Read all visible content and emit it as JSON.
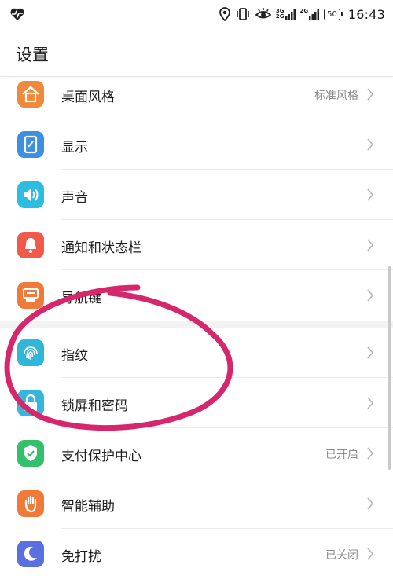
{
  "status_bar": {
    "signal_a": "3G",
    "signal_b": "2G",
    "network_type": "2G",
    "battery": "50",
    "time": "16:43"
  },
  "header": {
    "title": "设置"
  },
  "settings": {
    "items": [
      {
        "label": "桌面风格",
        "value": "标准风格",
        "icon": "home-icon",
        "color": "#ef8a3c"
      },
      {
        "label": "显示",
        "value": "",
        "icon": "display-icon",
        "color": "#3d8fe0"
      },
      {
        "label": "声音",
        "value": "",
        "icon": "speaker-icon",
        "color": "#2ebde0"
      },
      {
        "label": "通知和状态栏",
        "value": "",
        "icon": "bell-icon",
        "color": "#ef5a4a"
      },
      {
        "label": "导航键",
        "value": "",
        "icon": "navigation-key-icon",
        "color": "#ef7a3a"
      },
      {
        "label": "指纹",
        "value": "",
        "icon": "fingerprint-icon",
        "color": "#2fb6d9"
      },
      {
        "label": "锁屏和密码",
        "value": "",
        "icon": "lock-icon",
        "color": "#35b6da"
      },
      {
        "label": "支付保护中心",
        "value": "已开启",
        "icon": "shield-check-icon",
        "color": "#33c06a"
      },
      {
        "label": "智能辅助",
        "value": "",
        "icon": "hand-icon",
        "color": "#f07a3a"
      },
      {
        "label": "免打扰",
        "value": "已关闭",
        "icon": "moon-icon",
        "color": "#5a6fe0"
      }
    ]
  },
  "colors": {
    "annotation_stroke": "#d6276d"
  }
}
